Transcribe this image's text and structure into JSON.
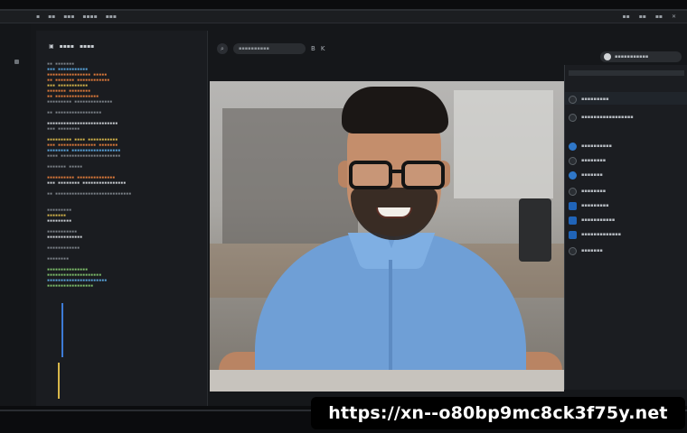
{
  "watermark": {
    "url": "https://xn--o80bp9mc8ck3f75y.net"
  },
  "colors": {
    "video_bg": "#a9a7a3",
    "shirt": "#6f9fd6",
    "accent_blue": "#2f77c8",
    "banner_bg": "#000000",
    "banner_text": "#ffffff"
  },
  "icons": {
    "toolbar": [
      "search-icon",
      "bold-icon",
      "italic-icon"
    ],
    "sidebar": [
      "app-icon",
      "app-icon",
      "app-icon",
      "app-icon",
      "app-icon",
      "app-icon",
      "app-icon",
      "app-icon"
    ]
  }
}
